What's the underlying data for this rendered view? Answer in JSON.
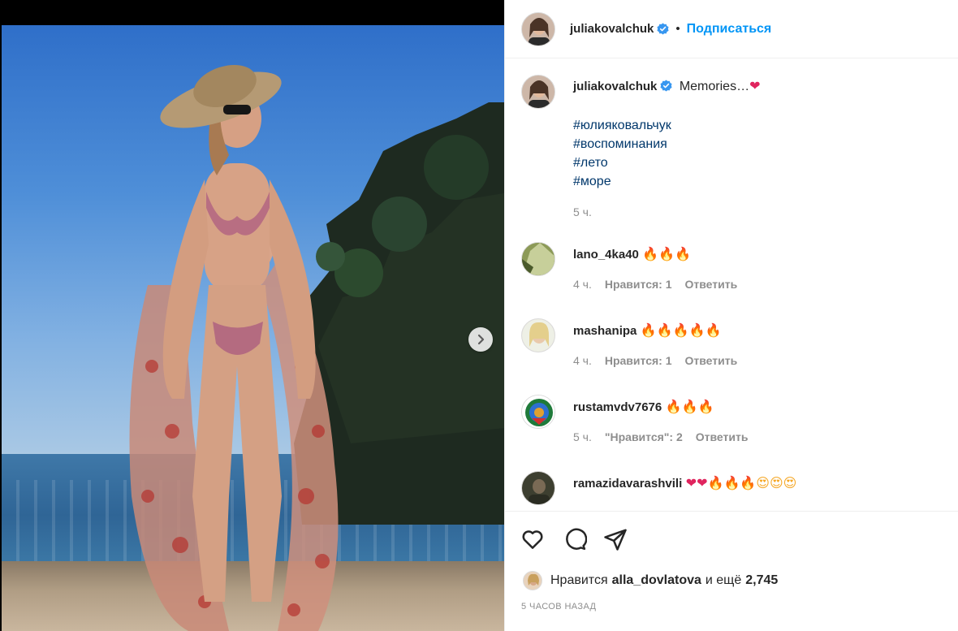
{
  "post": {
    "author": "juliakovalchuk",
    "follow_label": "Подписаться",
    "separator": "•",
    "caption_text": "Memories…",
    "hashtags": [
      "#юлияковальчук",
      "#воспоминания",
      "#лето",
      "#море"
    ],
    "caption_time": "5 ч.",
    "likes_prefix": "Нравится",
    "likes_user": "alla_dovlatova",
    "likes_and": "и ещё",
    "likes_count": "2,745",
    "date_label": "5 ЧАСОВ НАЗАД"
  },
  "comments": [
    {
      "user": "lano_4ka40",
      "emoji": [
        "fire",
        "fire",
        "fire"
      ],
      "time": "4 ч.",
      "likes": "Нравится: 1",
      "reply": "Ответить"
    },
    {
      "user": "mashanipa",
      "emoji": [
        "fire",
        "fire",
        "fire",
        "fire",
        "fire"
      ],
      "time": "4 ч.",
      "likes": "Нравится: 1",
      "reply": "Ответить"
    },
    {
      "user": "rustamvdv7676",
      "emoji": [
        "fire",
        "fire",
        "fire"
      ],
      "time": "5 ч.",
      "likes": "\"Нравится\": 2",
      "reply": "Ответить"
    },
    {
      "user": "ramazidavarashvili",
      "emoji": [
        "heart",
        "heart",
        "fire",
        "fire",
        "fire",
        "love",
        "love",
        "love"
      ]
    }
  ],
  "icons": {
    "like": "heart-outline-icon",
    "comment": "speech-bubble-icon",
    "share": "paper-plane-icon",
    "next": "chevron-right-icon",
    "verified": "verified-badge-icon"
  },
  "colors": {
    "link_blue": "#0095f6",
    "hashtag": "#00376b",
    "muted": "#8e8e8e",
    "verified": "#3897f0"
  }
}
